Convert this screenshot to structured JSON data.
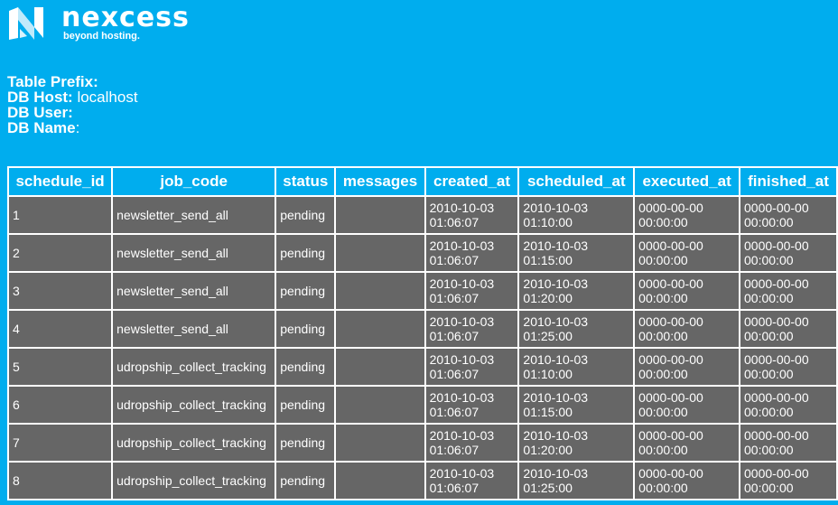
{
  "brand": {
    "name": "nexcess",
    "tagline": "beyond hosting.",
    "logo_icon": "nexcess-logo-icon"
  },
  "db_info": {
    "table_prefix_label": "Table Prefix:",
    "table_prefix_value": "",
    "db_host_label": "DB Host:",
    "db_host_value": " localhost",
    "db_user_label": "DB User:",
    "db_user_value": "",
    "db_name_label": "DB Name",
    "db_name_value": ":"
  },
  "table": {
    "columns": [
      "schedule_id",
      "job_code",
      "status",
      "messages",
      "created_at",
      "scheduled_at",
      "executed_at",
      "finished_at"
    ],
    "rows": [
      {
        "schedule_id": "1",
        "job_code": "newsletter_send_all",
        "status": "pending",
        "messages": "",
        "created_at": "2010-10-03 01:06:07",
        "scheduled_at": "2010-10-03 01:10:00",
        "executed_at": "0000-00-00 00:00:00",
        "finished_at": "0000-00-00 00:00:00"
      },
      {
        "schedule_id": "2",
        "job_code": "newsletter_send_all",
        "status": "pending",
        "messages": "",
        "created_at": "2010-10-03 01:06:07",
        "scheduled_at": "2010-10-03 01:15:00",
        "executed_at": "0000-00-00 00:00:00",
        "finished_at": "0000-00-00 00:00:00"
      },
      {
        "schedule_id": "3",
        "job_code": "newsletter_send_all",
        "status": "pending",
        "messages": "",
        "created_at": "2010-10-03 01:06:07",
        "scheduled_at": "2010-10-03 01:20:00",
        "executed_at": "0000-00-00 00:00:00",
        "finished_at": "0000-00-00 00:00:00"
      },
      {
        "schedule_id": "4",
        "job_code": "newsletter_send_all",
        "status": "pending",
        "messages": "",
        "created_at": "2010-10-03 01:06:07",
        "scheduled_at": "2010-10-03 01:25:00",
        "executed_at": "0000-00-00 00:00:00",
        "finished_at": "0000-00-00 00:00:00"
      },
      {
        "schedule_id": "5",
        "job_code": "udropship_collect_tracking",
        "status": "pending",
        "messages": "",
        "created_at": "2010-10-03 01:06:07",
        "scheduled_at": "2010-10-03 01:10:00",
        "executed_at": "0000-00-00 00:00:00",
        "finished_at": "0000-00-00 00:00:00"
      },
      {
        "schedule_id": "6",
        "job_code": "udropship_collect_tracking",
        "status": "pending",
        "messages": "",
        "created_at": "2010-10-03 01:06:07",
        "scheduled_at": "2010-10-03 01:15:00",
        "executed_at": "0000-00-00 00:00:00",
        "finished_at": "0000-00-00 00:00:00"
      },
      {
        "schedule_id": "7",
        "job_code": "udropship_collect_tracking",
        "status": "pending",
        "messages": "",
        "created_at": "2010-10-03 01:06:07",
        "scheduled_at": "2010-10-03 01:20:00",
        "executed_at": "0000-00-00 00:00:00",
        "finished_at": "0000-00-00 00:00:00"
      },
      {
        "schedule_id": "8",
        "job_code": "udropship_collect_tracking",
        "status": "pending",
        "messages": "",
        "created_at": "2010-10-03 01:06:07",
        "scheduled_at": "2010-10-03 01:25:00",
        "executed_at": "0000-00-00 00:00:00",
        "finished_at": "0000-00-00 00:00:00"
      }
    ]
  },
  "colors": {
    "background": "#00adee",
    "cell_bg": "#666666",
    "grid": "#ffffff",
    "text": "#ffffff"
  }
}
